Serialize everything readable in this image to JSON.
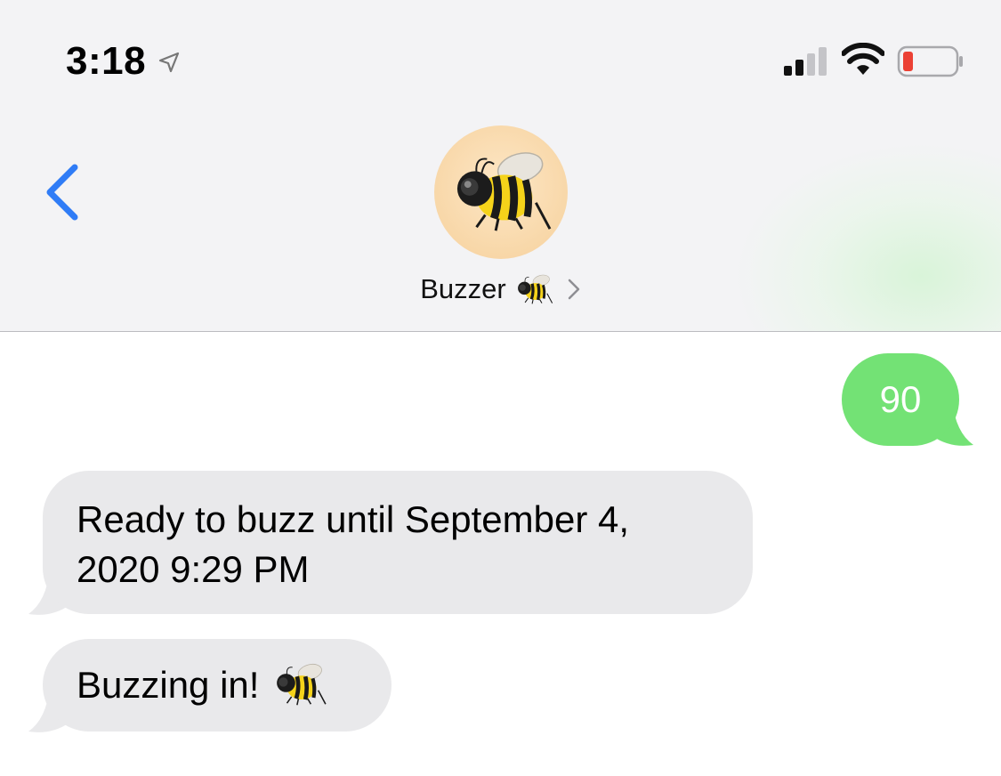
{
  "status_bar": {
    "time": "3:18",
    "location_icon": "location-arrow-icon",
    "signal_icon": "cellular-signal-icon",
    "wifi_icon": "wifi-icon",
    "battery_icon": "battery-low-icon",
    "battery_level": 0.12
  },
  "header": {
    "back_icon": "chevron-left-icon",
    "avatar_icon": "bee-icon",
    "contact_name": "Buzzer",
    "contact_emoji_icon": "bee-icon",
    "chevron_icon": "chevron-right-icon"
  },
  "messages": [
    {
      "direction": "sent",
      "text": "90"
    },
    {
      "direction": "received",
      "text": "Ready to buzz until September 4, 2020 9:29 PM"
    },
    {
      "direction": "received",
      "text": "Buzzing in!",
      "emoji_icon": "bee-icon"
    }
  ],
  "colors": {
    "accent_blue": "#2f7cf6",
    "sent_bubble": "#73e275",
    "received_bubble": "#e9e9eb",
    "battery_low": "#eb4034"
  }
}
